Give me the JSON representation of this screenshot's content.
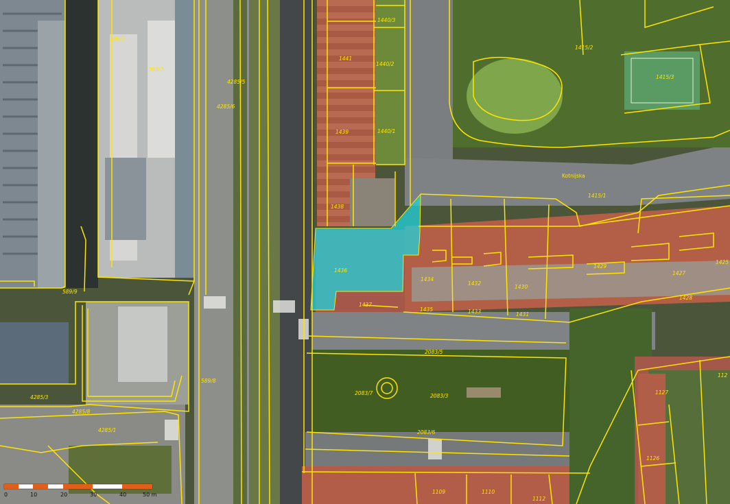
{
  "map": {
    "parcels": [
      "1440/3",
      "1440/2",
      "1440/1",
      "1441",
      "1439",
      "1438",
      "1436",
      "1437",
      "1435",
      "1434",
      "1433",
      "1432",
      "1431",
      "1430",
      "1429",
      "1428",
      "1427",
      "1425",
      "1415/2",
      "1415/3",
      "1415/1",
      "589/2",
      "589/3",
      "589/9",
      "589/8",
      "4285/5",
      "4285/6",
      "4285/3",
      "4285/1",
      "4285/8",
      "2083/5",
      "2083/7",
      "2083/3",
      "2083/6",
      "1127",
      "1126",
      "1109",
      "1110",
      "1112",
      "112"
    ],
    "street_name": "Kotnijska",
    "highlight_parcel": "1436",
    "highlight_color": "#21d3dc",
    "line_color": "#ffe500",
    "scale": {
      "unit": "m",
      "ticks": [
        "0",
        "10",
        "20",
        "30",
        "40",
        "50 m"
      ],
      "colors": [
        "#e0601a",
        "#ffffff"
      ]
    }
  }
}
